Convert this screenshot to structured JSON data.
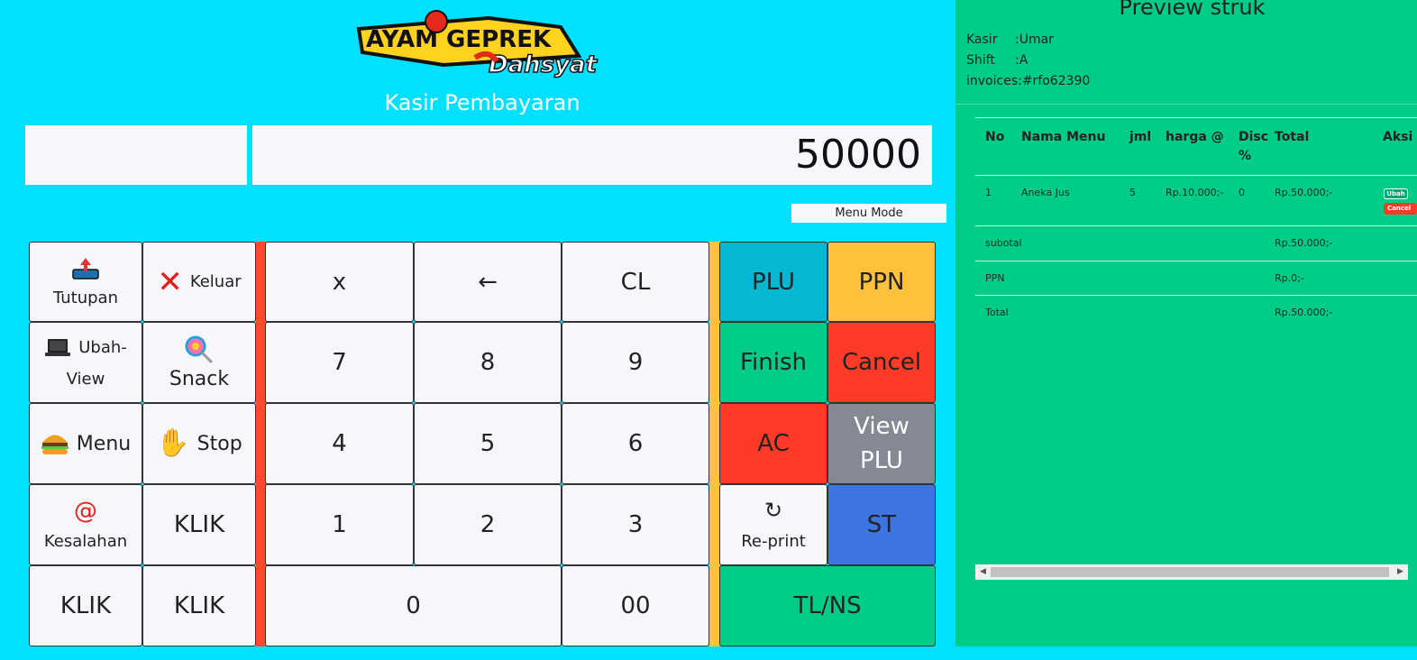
{
  "header": {
    "logo": {
      "line1": "AYAM GEPREK",
      "line2": "Dahsyat"
    },
    "title": "Kasir Pembayaran"
  },
  "display": {
    "left_value": "",
    "amount": "50000"
  },
  "menu_mode_label": "Menu Mode",
  "left_keys": {
    "tutupan": {
      "label": "Tutupan",
      "icon": "upload-tray-icon"
    },
    "keluar": {
      "label": "Keluar",
      "icon": "cross-mark-icon"
    },
    "ubah_view": {
      "label1": "Ubah-",
      "label2": "View",
      "icon": "laptop-icon"
    },
    "snack": {
      "label": "Snack",
      "icon": "lollipop-icon"
    },
    "menu": {
      "label": "Menu",
      "icon": "burger-icon"
    },
    "stop": {
      "label": "Stop",
      "icon": "raised-hand-icon"
    },
    "kesalahan": {
      "label": "Kesalahan",
      "icon": "at-sign-icon"
    },
    "klik1": "KLIK",
    "klik2": "KLIK",
    "klik3": "KLIK"
  },
  "numpad": {
    "x": "x",
    "back": "←",
    "cl": "CL",
    "n7": "7",
    "n8": "8",
    "n9": "9",
    "n4": "4",
    "n5": "5",
    "n6": "6",
    "n1": "1",
    "n2": "2",
    "n3": "3",
    "n0": "0",
    "n00": "00"
  },
  "function_keys": {
    "plu": "PLU",
    "ppn": "PPN",
    "finish": "Finish",
    "cancel": "Cancel",
    "ac": "AC",
    "view_plu1": "View",
    "view_plu2": "PLU",
    "reprint": "Re-print",
    "reprint_icon": "↻",
    "st": "ST",
    "tlns": "TL/NS"
  },
  "colors": {
    "background": "#00e0ff",
    "panel": "#00cc8a",
    "plu": "#04b8d2",
    "ppn": "#ffc23a",
    "finish": "#00cc8a",
    "cancel": "#ff3b28",
    "ac": "#ff3b28",
    "view_plu": "#848993",
    "st": "#3c74e0",
    "tlns": "#00cc8a"
  },
  "receipt": {
    "title": "Preview struk",
    "kasir_label": "Kasir",
    "kasir_value": ":Umar",
    "shift_label": "Shift",
    "shift_value": ":A",
    "invoice_label": "invoices",
    "invoice_value": ":#rfo62390",
    "columns": {
      "no": "No",
      "nama": "Nama Menu",
      "jml": "jml",
      "harga": "harga @",
      "disc1": "Disc",
      "disc2": "%",
      "total": "Total",
      "aksi": "Aksi"
    },
    "items": [
      {
        "no": "1",
        "nama": "Aneka Jus",
        "jml": "5",
        "harga": "Rp.10.000;-",
        "disc": "0",
        "total": "Rp.50.000;-"
      }
    ],
    "ubah_label": "Ubah",
    "cancel_label": "Cancel",
    "subtotal_label": "subotal",
    "subtotal_value": "Rp.50.000;-",
    "ppn_label": "PPN",
    "ppn_value": "Rp.0;-",
    "total_label": "Total",
    "total_value": "Rp.50.000;-"
  }
}
